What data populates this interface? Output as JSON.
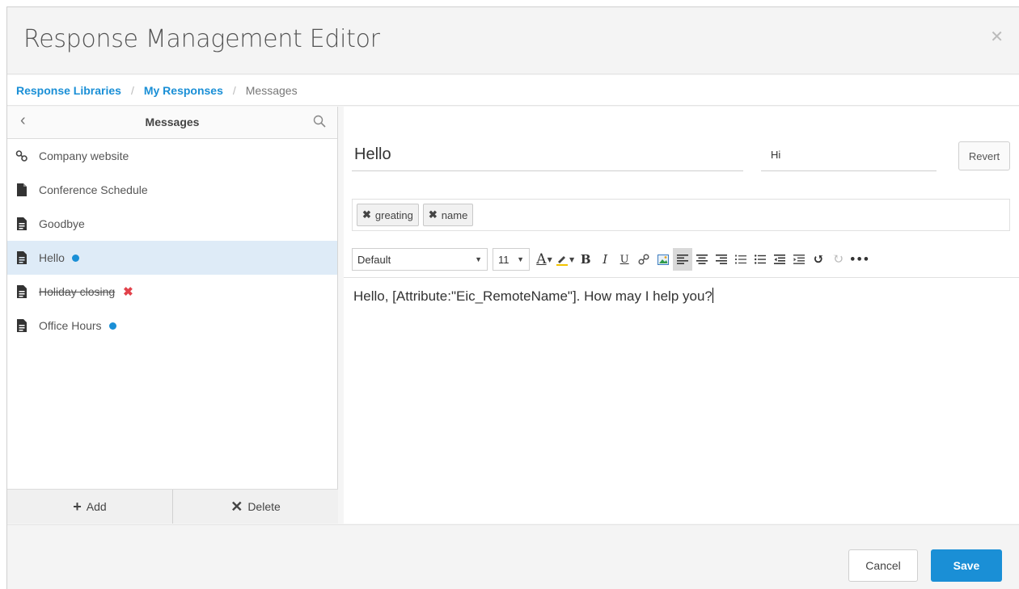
{
  "dialog": {
    "title": "Response Management Editor",
    "close_icon": "close-icon"
  },
  "breadcrumb": {
    "items": [
      {
        "label": "Response Libraries"
      },
      {
        "label": "My Responses"
      },
      {
        "label": "Messages"
      }
    ],
    "separator": "/"
  },
  "left_pane": {
    "title": "Messages",
    "items": [
      {
        "label": "Company website",
        "icon": "link-icon",
        "state": "normal"
      },
      {
        "label": "Conference Schedule",
        "icon": "file-icon",
        "state": "normal"
      },
      {
        "label": "Goodbye",
        "icon": "document-icon",
        "state": "normal"
      },
      {
        "label": "Hello",
        "icon": "document-icon",
        "state": "selected",
        "badge": "modified"
      },
      {
        "label": "Holiday closing",
        "icon": "document-icon",
        "state": "deleted",
        "badge": "deleted"
      },
      {
        "label": "Office Hours",
        "icon": "document-icon",
        "state": "normal",
        "badge": "modified"
      }
    ],
    "add_label": "Add",
    "delete_label": "Delete"
  },
  "editor": {
    "name_value": "Hello",
    "alias_value": "Hi",
    "revert_label": "Revert",
    "tags": [
      {
        "label": "greating"
      },
      {
        "label": "name"
      }
    ],
    "toolbar": {
      "font_family": "Default",
      "font_size": "11"
    },
    "body_text": "Hello, [Attribute:\"Eic_RemoteName\"]. How may I help you?"
  },
  "footer": {
    "cancel_label": "Cancel",
    "save_label": "Save"
  },
  "colors": {
    "accent": "#1a8fd6",
    "selected_row": "#deebf7",
    "deleted_mark": "#e2424b"
  }
}
